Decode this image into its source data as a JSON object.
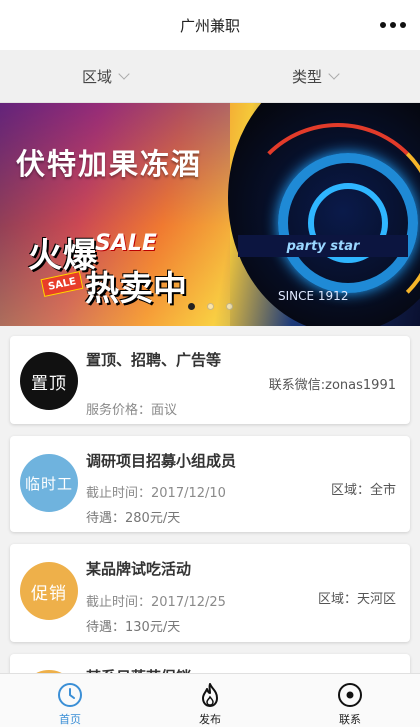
{
  "header": {
    "title": "广州兼职"
  },
  "filters": [
    {
      "label": "区域"
    },
    {
      "label": "类型"
    }
  ],
  "banner": {
    "headline": "伏特加果冻酒",
    "promo_hot": "火爆",
    "promo_sale": "SALE",
    "promo_selling": "热卖中",
    "tag": "SALE",
    "bottle_brand": "party star",
    "bottle_since": "SINCE 1912",
    "dots_active_index": 0,
    "dots_count": 3
  },
  "listings": [
    {
      "avatar_text": "置顶",
      "avatar_color": "#111111",
      "title": "置顶、招聘、广告等",
      "contact": "联系微信:zonas1991",
      "price": "服务价格：面议"
    },
    {
      "avatar_text": "临时工",
      "avatar_color": "#6fb3de",
      "title": "调研项目招募小组成员",
      "deadline": "截止时间：2017/12/10",
      "area": "区域：全市",
      "pay": "待遇：280元/天"
    },
    {
      "avatar_text": "促销",
      "avatar_color": "#eeb04a",
      "title": "某品牌试吃活动",
      "deadline": "截止时间：2017/12/25",
      "area": "区域：天河区",
      "pay": "待遇：130元/天"
    },
    {
      "avatar_text": "",
      "avatar_color": "#eeb04a",
      "title": "某系日落花促销"
    }
  ],
  "nav": [
    {
      "label": "首页",
      "icon": "clock-icon",
      "active": true
    },
    {
      "label": "发布",
      "icon": "flame-icon",
      "active": false
    },
    {
      "label": "联系",
      "icon": "target-icon",
      "active": false
    }
  ],
  "colors": {
    "accent": "#3b8fd6"
  }
}
